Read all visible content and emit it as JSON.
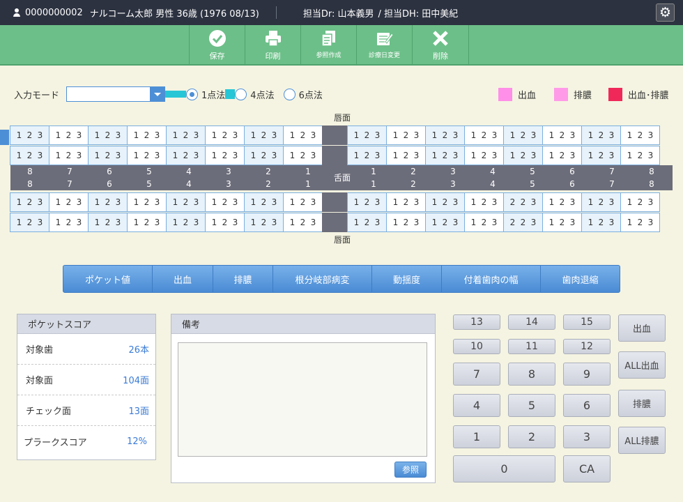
{
  "header": {
    "patient_id": "0000000002",
    "patient_info": "ナルコーム太郎 男性 36歳 (1976 08/13)",
    "doctor": "担当Dr: 山本義男",
    "hygienist": "/ 担当DH: 田中美紀",
    "icons": {
      "user": "user-icon",
      "settings": "gear-icon"
    }
  },
  "toolbar": {
    "save": "保存",
    "print": "印刷",
    "reference": "参照作成",
    "change_date": "診療日変更",
    "delete": "削除"
  },
  "input_mode": {
    "label": "入力モード",
    "select_value": "",
    "options": [
      {
        "label": "1点法",
        "selected": true
      },
      {
        "label": "4点法",
        "selected": false
      },
      {
        "label": "6点法",
        "selected": false
      }
    ]
  },
  "legend": [
    {
      "label": "出血",
      "color": "#ff8fe8"
    },
    {
      "label": "排膿",
      "color": "#ff9ae8"
    },
    {
      "label": "出血･排膿",
      "color": "#f0285a"
    }
  ],
  "chart": {
    "lip_top": "唇面",
    "lip_bottom": "唇面",
    "tongue": "舌面",
    "upper_rows": [
      [
        "1",
        "2",
        "3",
        "1",
        "2",
        "3",
        "1",
        "2",
        "3",
        "1",
        "2",
        "3",
        "1",
        "2",
        "3",
        "1",
        "2",
        "3",
        "1",
        "2",
        "3",
        "1",
        "2",
        "3",
        "1",
        "2",
        "3",
        "1",
        "2",
        "3",
        "1",
        "2",
        "3",
        "1",
        "2",
        "3",
        "1",
        "2",
        "3",
        "1",
        "2",
        "3",
        "1",
        "2",
        "3",
        "1",
        "2",
        "3"
      ],
      [
        "1",
        "2",
        "3",
        "1",
        "2",
        "3",
        "1",
        "2",
        "3",
        "1",
        "2",
        "3",
        "1",
        "2",
        "3",
        "1",
        "2",
        "3",
        "1",
        "2",
        "3",
        "1",
        "2",
        "3",
        "1",
        "2",
        "3",
        "1",
        "2",
        "3",
        "1",
        "2",
        "3",
        "1",
        "2",
        "3",
        "1",
        "2",
        "3",
        "1",
        "2",
        "3",
        "1",
        "2",
        "3",
        "1",
        "2",
        "3"
      ]
    ],
    "lower_rows": [
      [
        "1",
        "2",
        "3",
        "1",
        "2",
        "3",
        "1",
        "2",
        "3",
        "1",
        "2",
        "3",
        "1",
        "2",
        "3",
        "1",
        "2",
        "3",
        "1",
        "2",
        "3",
        "1",
        "2",
        "3",
        "1",
        "2",
        "3",
        "1",
        "2",
        "3",
        "1",
        "2",
        "3",
        "1",
        "2",
        "3",
        "2",
        "2",
        "3",
        "1",
        "2",
        "3",
        "1",
        "2",
        "3",
        "1",
        "2",
        "3"
      ],
      [
        "1",
        "2",
        "3",
        "1",
        "2",
        "3",
        "1",
        "2",
        "3",
        "1",
        "2",
        "3",
        "1",
        "2",
        "3",
        "1",
        "2",
        "3",
        "1",
        "2",
        "3",
        "1",
        "2",
        "3",
        "1",
        "2",
        "3",
        "1",
        "2",
        "3",
        "1",
        "2",
        "3",
        "1",
        "2",
        "3",
        "2",
        "2",
        "3",
        "1",
        "2",
        "3",
        "1",
        "2",
        "3",
        "1",
        "2",
        "3"
      ]
    ],
    "tooth_numbers_left": [
      "8",
      "7",
      "6",
      "5",
      "4",
      "3",
      "2",
      "1"
    ],
    "tooth_numbers_right": [
      "1",
      "2",
      "3",
      "4",
      "5",
      "6",
      "7",
      "8"
    ]
  },
  "tabs": [
    "ポケット値",
    "出血",
    "排膿",
    "根分岐部病変",
    "動揺度",
    "付着歯肉の幅",
    "歯肉退縮"
  ],
  "pocket_score": {
    "title": "ポケットスコア",
    "rows": [
      {
        "label": "対象歯",
        "value": "26本"
      },
      {
        "label": "対象面",
        "value": "104面"
      },
      {
        "label": "チェック面",
        "value": "13面"
      },
      {
        "label": "プラークスコア",
        "value": "12%"
      }
    ]
  },
  "notes": {
    "title": "備考",
    "value": "",
    "reference_button": "参照"
  },
  "keypad": {
    "keys": [
      "13",
      "14",
      "15",
      "10",
      "11",
      "12",
      "7",
      "8",
      "9",
      "4",
      "5",
      "6",
      "1",
      "2",
      "3",
      "0",
      "CA"
    ],
    "side": [
      "出血",
      "ALL出血",
      "排膿",
      "ALL排膿"
    ]
  }
}
